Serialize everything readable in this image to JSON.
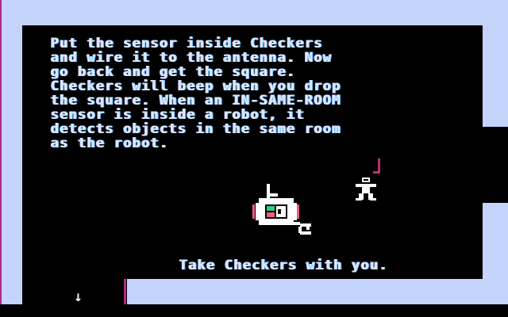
{
  "message": "Put the sensor inside Checkers\nand wire it to the antenna. Now\ngo back and get the square.\nCheckers will beep when you drop\nthe square. When an IN-SAME-ROOM\nsensor is inside a robot, it\ndetects objects in the same room\nas the robot.",
  "prompt": "Take Checkers with you.",
  "icons": {
    "down_arrow": "↓"
  },
  "sprites": [
    "checkers-robot",
    "player-figure",
    "antenna"
  ],
  "colors": {
    "wall": "#c4d4fb",
    "room": "#000000",
    "text": "#d9e8ff",
    "accent_magenta": "#b02a8a"
  }
}
